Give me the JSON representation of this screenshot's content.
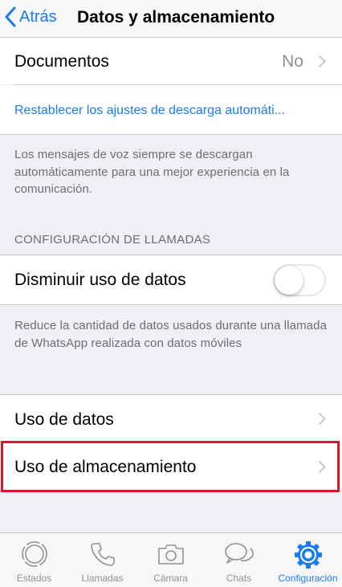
{
  "nav": {
    "back_label": "Atrás",
    "title": "Datos y almacenamiento"
  },
  "documents": {
    "label": "Documentos",
    "value": "No"
  },
  "reset_link": "Restablecer los ajustes de descarga automáti...",
  "voice_footer": "Los mensajes de voz siempre se descargan automáticamente para una mejor experiencia en la comunicación.",
  "calls_section": {
    "header": "CONFIGURACIÓN DE LLAMADAS",
    "low_data_label": "Disminuir uso de datos",
    "low_data_enabled": false,
    "footer": "Reduce la cantidad de datos usados durante una llamada de WhatsApp realizada con datos móviles"
  },
  "usage": {
    "data_label": "Uso de datos",
    "storage_label": "Uso de almacenamiento"
  },
  "tabs": [
    {
      "label": "Estados",
      "icon": "status-icon",
      "active": false
    },
    {
      "label": "Llamadas",
      "icon": "phone-icon",
      "active": false
    },
    {
      "label": "Cámara",
      "icon": "camera-icon",
      "active": false
    },
    {
      "label": "Chats",
      "icon": "chats-icon",
      "active": false
    },
    {
      "label": "Configuración",
      "icon": "settings-gear-icon",
      "active": true
    }
  ],
  "colors": {
    "accent": "#1b7bf1",
    "highlight": "#d9182c",
    "background": "#efeff4"
  }
}
